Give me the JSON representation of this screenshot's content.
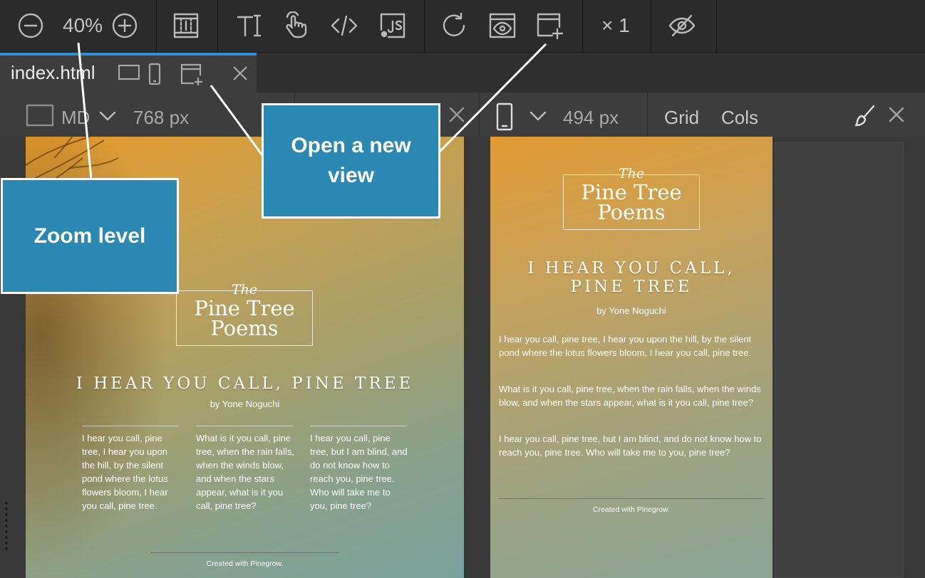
{
  "toolbar": {
    "zoom": "40%",
    "multiplier": "× 1",
    "buttons": [
      "zoom-out-icon",
      "zoom-in-icon",
      "page-layout-icon",
      "text-edit-icon",
      "interact-icon",
      "code-icon",
      "javascript-icon",
      "refresh-icon",
      "preview-icon",
      "new-view-icon",
      "hide-icon"
    ]
  },
  "tab": {
    "filename": "index.html"
  },
  "views": {
    "left": {
      "size_label": "MD",
      "width_label": "768 px"
    },
    "right": {
      "width_label": "494 px",
      "grid_label": "Grid",
      "cols_label": "Cols"
    }
  },
  "page": {
    "logo_the": "The",
    "logo_line1": "Pine Tree",
    "logo_line2": "Poems",
    "heading": "I HEAR YOU CALL, PINE TREE",
    "heading_line1": "I HEAR YOU CALL,",
    "heading_line2": "PINE TREE",
    "byline": "by Yone Noguchi",
    "paragraphs": [
      "I hear you call, pine tree, I hear you upon the hill, by the silent pond where the lotus flowers bloom, I hear you call, pine tree.",
      "What is it you call, pine tree, when the rain falls, when the winds blow, and when the stars appear, what is it you call, pine tree?",
      "I hear you call, pine tree, but I am blind, and do not know how to reach you, pine tree. Who will take me to you, pine tree?"
    ],
    "footer": "Created with Pinegrow."
  },
  "callouts": {
    "new_view": "Open a new view",
    "new_view_line1": "Open a new",
    "new_view_line2": "view",
    "zoom": "Zoom level"
  },
  "colors": {
    "callout_bg": "#2a88b3",
    "tab_accent": "#2f8fd1",
    "chrome_dark": "#2b2b2b"
  }
}
